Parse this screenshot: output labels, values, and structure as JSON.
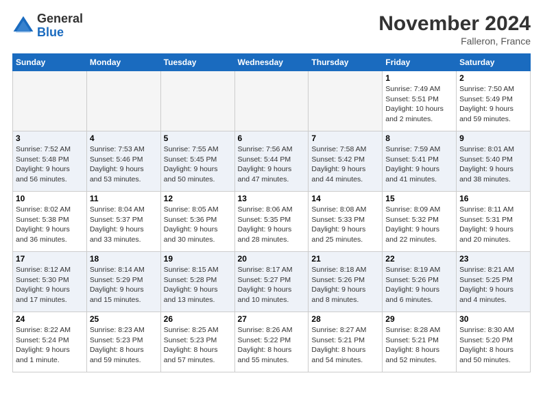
{
  "logo": {
    "general": "General",
    "blue": "Blue"
  },
  "title": "November 2024",
  "location": "Falleron, France",
  "weekdays": [
    "Sunday",
    "Monday",
    "Tuesday",
    "Wednesday",
    "Thursday",
    "Friday",
    "Saturday"
  ],
  "weeks": [
    [
      {
        "day": "",
        "empty": true
      },
      {
        "day": "",
        "empty": true
      },
      {
        "day": "",
        "empty": true
      },
      {
        "day": "",
        "empty": true
      },
      {
        "day": "",
        "empty": true
      },
      {
        "day": "1",
        "sunrise": "Sunrise: 7:49 AM",
        "sunset": "Sunset: 5:51 PM",
        "daylight": "Daylight: 10 hours and 2 minutes."
      },
      {
        "day": "2",
        "sunrise": "Sunrise: 7:50 AM",
        "sunset": "Sunset: 5:49 PM",
        "daylight": "Daylight: 9 hours and 59 minutes."
      }
    ],
    [
      {
        "day": "3",
        "sunrise": "Sunrise: 7:52 AM",
        "sunset": "Sunset: 5:48 PM",
        "daylight": "Daylight: 9 hours and 56 minutes."
      },
      {
        "day": "4",
        "sunrise": "Sunrise: 7:53 AM",
        "sunset": "Sunset: 5:46 PM",
        "daylight": "Daylight: 9 hours and 53 minutes."
      },
      {
        "day": "5",
        "sunrise": "Sunrise: 7:55 AM",
        "sunset": "Sunset: 5:45 PM",
        "daylight": "Daylight: 9 hours and 50 minutes."
      },
      {
        "day": "6",
        "sunrise": "Sunrise: 7:56 AM",
        "sunset": "Sunset: 5:44 PM",
        "daylight": "Daylight: 9 hours and 47 minutes."
      },
      {
        "day": "7",
        "sunrise": "Sunrise: 7:58 AM",
        "sunset": "Sunset: 5:42 PM",
        "daylight": "Daylight: 9 hours and 44 minutes."
      },
      {
        "day": "8",
        "sunrise": "Sunrise: 7:59 AM",
        "sunset": "Sunset: 5:41 PM",
        "daylight": "Daylight: 9 hours and 41 minutes."
      },
      {
        "day": "9",
        "sunrise": "Sunrise: 8:01 AM",
        "sunset": "Sunset: 5:40 PM",
        "daylight": "Daylight: 9 hours and 38 minutes."
      }
    ],
    [
      {
        "day": "10",
        "sunrise": "Sunrise: 8:02 AM",
        "sunset": "Sunset: 5:38 PM",
        "daylight": "Daylight: 9 hours and 36 minutes."
      },
      {
        "day": "11",
        "sunrise": "Sunrise: 8:04 AM",
        "sunset": "Sunset: 5:37 PM",
        "daylight": "Daylight: 9 hours and 33 minutes."
      },
      {
        "day": "12",
        "sunrise": "Sunrise: 8:05 AM",
        "sunset": "Sunset: 5:36 PM",
        "daylight": "Daylight: 9 hours and 30 minutes."
      },
      {
        "day": "13",
        "sunrise": "Sunrise: 8:06 AM",
        "sunset": "Sunset: 5:35 PM",
        "daylight": "Daylight: 9 hours and 28 minutes."
      },
      {
        "day": "14",
        "sunrise": "Sunrise: 8:08 AM",
        "sunset": "Sunset: 5:33 PM",
        "daylight": "Daylight: 9 hours and 25 minutes."
      },
      {
        "day": "15",
        "sunrise": "Sunrise: 8:09 AM",
        "sunset": "Sunset: 5:32 PM",
        "daylight": "Daylight: 9 hours and 22 minutes."
      },
      {
        "day": "16",
        "sunrise": "Sunrise: 8:11 AM",
        "sunset": "Sunset: 5:31 PM",
        "daylight": "Daylight: 9 hours and 20 minutes."
      }
    ],
    [
      {
        "day": "17",
        "sunrise": "Sunrise: 8:12 AM",
        "sunset": "Sunset: 5:30 PM",
        "daylight": "Daylight: 9 hours and 17 minutes."
      },
      {
        "day": "18",
        "sunrise": "Sunrise: 8:14 AM",
        "sunset": "Sunset: 5:29 PM",
        "daylight": "Daylight: 9 hours and 15 minutes."
      },
      {
        "day": "19",
        "sunrise": "Sunrise: 8:15 AM",
        "sunset": "Sunset: 5:28 PM",
        "daylight": "Daylight: 9 hours and 13 minutes."
      },
      {
        "day": "20",
        "sunrise": "Sunrise: 8:17 AM",
        "sunset": "Sunset: 5:27 PM",
        "daylight": "Daylight: 9 hours and 10 minutes."
      },
      {
        "day": "21",
        "sunrise": "Sunrise: 8:18 AM",
        "sunset": "Sunset: 5:26 PM",
        "daylight": "Daylight: 9 hours and 8 minutes."
      },
      {
        "day": "22",
        "sunrise": "Sunrise: 8:19 AM",
        "sunset": "Sunset: 5:26 PM",
        "daylight": "Daylight: 9 hours and 6 minutes."
      },
      {
        "day": "23",
        "sunrise": "Sunrise: 8:21 AM",
        "sunset": "Sunset: 5:25 PM",
        "daylight": "Daylight: 9 hours and 4 minutes."
      }
    ],
    [
      {
        "day": "24",
        "sunrise": "Sunrise: 8:22 AM",
        "sunset": "Sunset: 5:24 PM",
        "daylight": "Daylight: 9 hours and 1 minute."
      },
      {
        "day": "25",
        "sunrise": "Sunrise: 8:23 AM",
        "sunset": "Sunset: 5:23 PM",
        "daylight": "Daylight: 8 hours and 59 minutes."
      },
      {
        "day": "26",
        "sunrise": "Sunrise: 8:25 AM",
        "sunset": "Sunset: 5:23 PM",
        "daylight": "Daylight: 8 hours and 57 minutes."
      },
      {
        "day": "27",
        "sunrise": "Sunrise: 8:26 AM",
        "sunset": "Sunset: 5:22 PM",
        "daylight": "Daylight: 8 hours and 55 minutes."
      },
      {
        "day": "28",
        "sunrise": "Sunrise: 8:27 AM",
        "sunset": "Sunset: 5:21 PM",
        "daylight": "Daylight: 8 hours and 54 minutes."
      },
      {
        "day": "29",
        "sunrise": "Sunrise: 8:28 AM",
        "sunset": "Sunset: 5:21 PM",
        "daylight": "Daylight: 8 hours and 52 minutes."
      },
      {
        "day": "30",
        "sunrise": "Sunrise: 8:30 AM",
        "sunset": "Sunset: 5:20 PM",
        "daylight": "Daylight: 8 hours and 50 minutes."
      }
    ]
  ]
}
